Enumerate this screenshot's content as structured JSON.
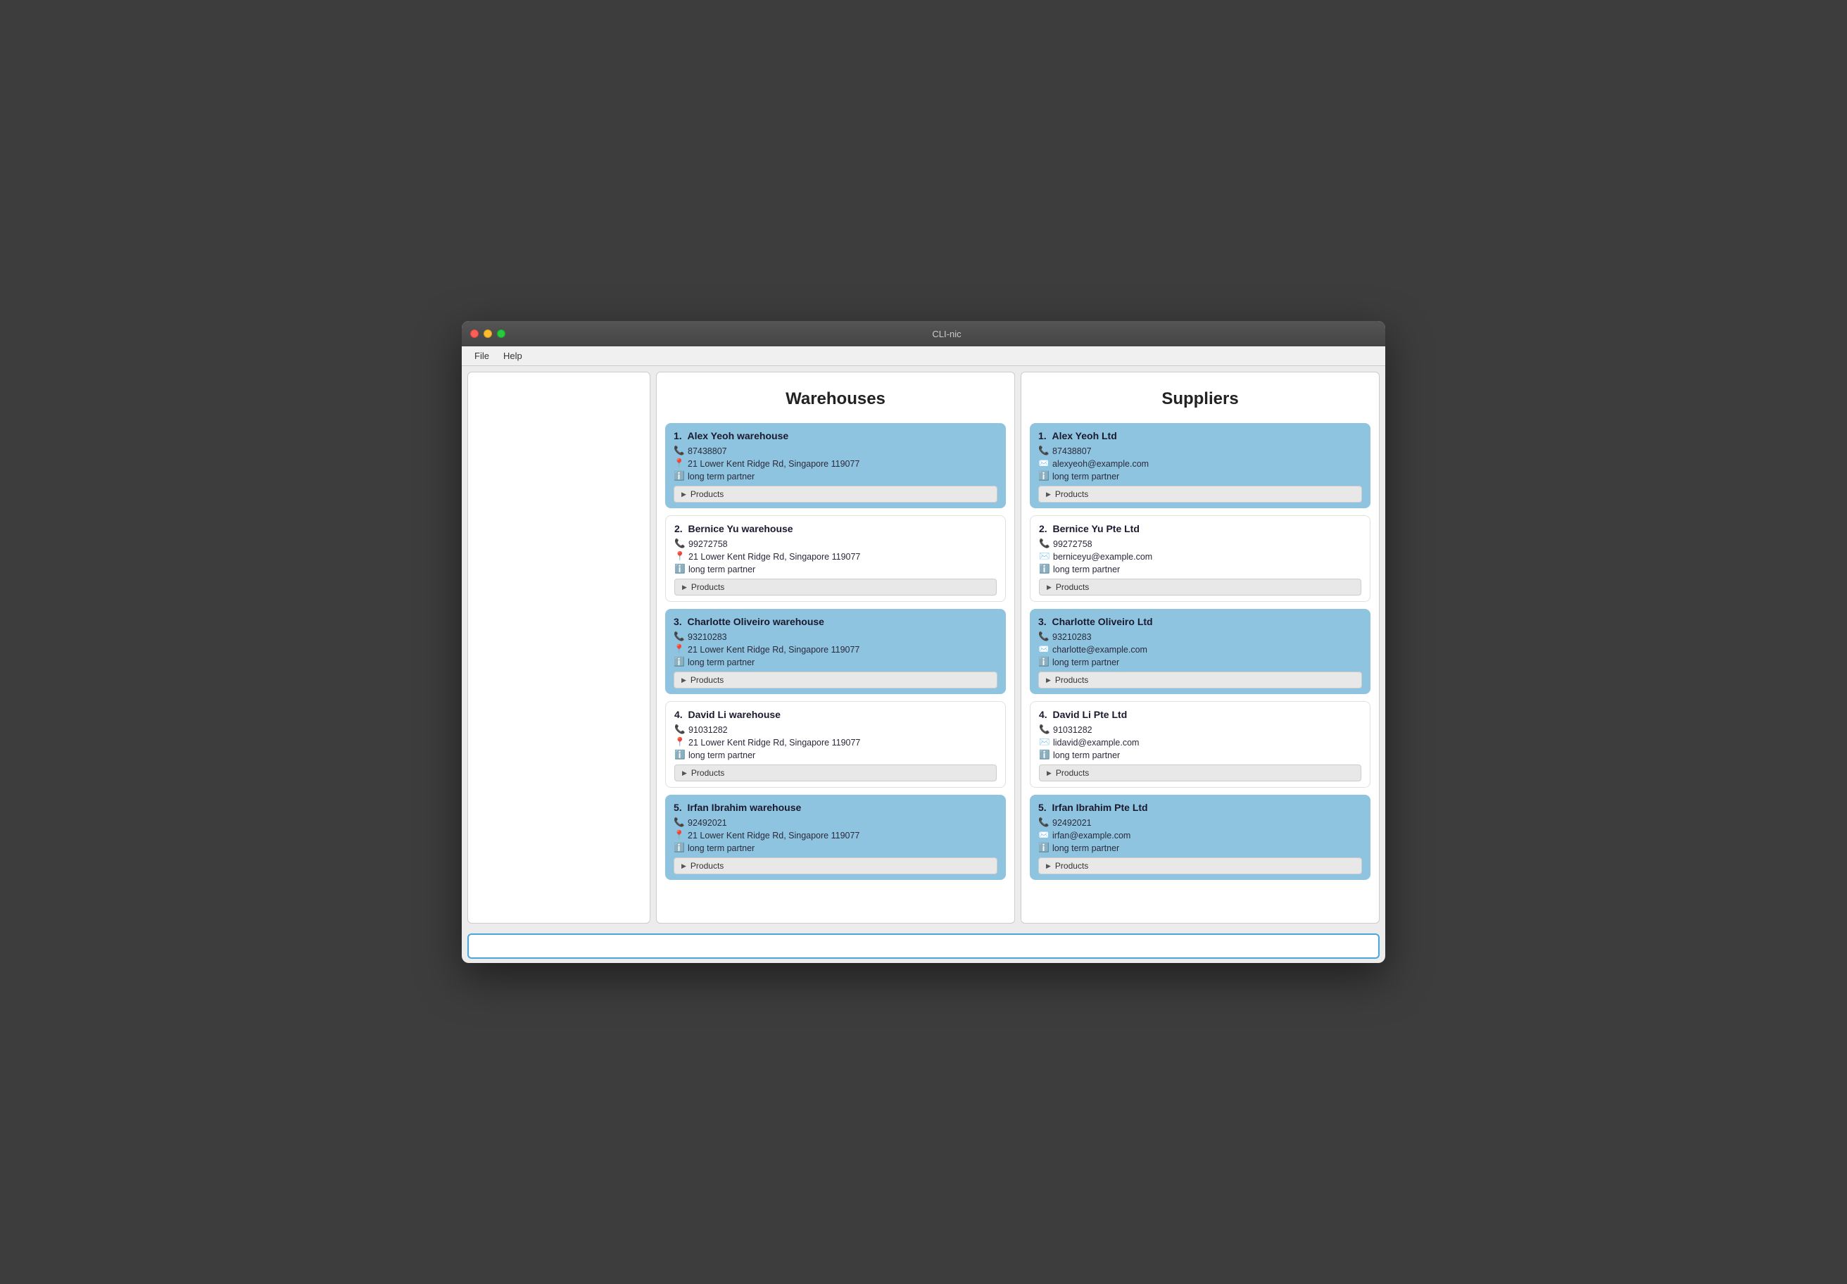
{
  "window": {
    "title": "CLI-nic"
  },
  "menu": {
    "items": [
      "File",
      "Help"
    ]
  },
  "warehouses": {
    "title": "Warehouses",
    "items": [
      {
        "num": "1.",
        "name": "Alex Yeoh warehouse",
        "phone": "87438807",
        "address": "21 Lower Kent Ridge Rd, Singapore 119077",
        "note": "long term partner",
        "highlighted": true
      },
      {
        "num": "2.",
        "name": "Bernice Yu warehouse",
        "phone": "99272758",
        "address": "21 Lower Kent Ridge Rd, Singapore 119077",
        "note": "long term partner",
        "highlighted": false
      },
      {
        "num": "3.",
        "name": "Charlotte Oliveiro warehouse",
        "phone": "93210283",
        "address": "21 Lower Kent Ridge Rd, Singapore 119077",
        "note": "long term partner",
        "highlighted": true
      },
      {
        "num": "4.",
        "name": "David Li warehouse",
        "phone": "91031282",
        "address": "21 Lower Kent Ridge Rd, Singapore 119077",
        "note": "long term partner",
        "highlighted": false
      },
      {
        "num": "5.",
        "name": "Irfan Ibrahim warehouse",
        "phone": "92492021",
        "address": "21 Lower Kent Ridge Rd, Singapore 119077",
        "note": "long term partner",
        "highlighted": true
      }
    ],
    "products_label": "Products"
  },
  "suppliers": {
    "title": "Suppliers",
    "items": [
      {
        "num": "1.",
        "name": "Alex Yeoh Ltd",
        "phone": "87438807",
        "email": "alexyeoh@example.com",
        "note": "long term partner",
        "highlighted": true
      },
      {
        "num": "2.",
        "name": "Bernice Yu Pte Ltd",
        "phone": "99272758",
        "email": "berniceyu@example.com",
        "note": "long term partner",
        "highlighted": false
      },
      {
        "num": "3.",
        "name": "Charlotte Oliveiro Ltd",
        "phone": "93210283",
        "email": "charlotte@example.com",
        "note": "long term partner",
        "highlighted": true
      },
      {
        "num": "4.",
        "name": "David Li Pte Ltd",
        "phone": "91031282",
        "email": "lidavid@example.com",
        "note": "long term partner",
        "highlighted": false
      },
      {
        "num": "5.",
        "name": "Irfan Ibrahim Pte Ltd",
        "phone": "92492021",
        "email": "irfan@example.com",
        "note": "long term partner",
        "highlighted": true
      }
    ],
    "products_label": "Products"
  },
  "bottom_input": {
    "placeholder": ""
  }
}
